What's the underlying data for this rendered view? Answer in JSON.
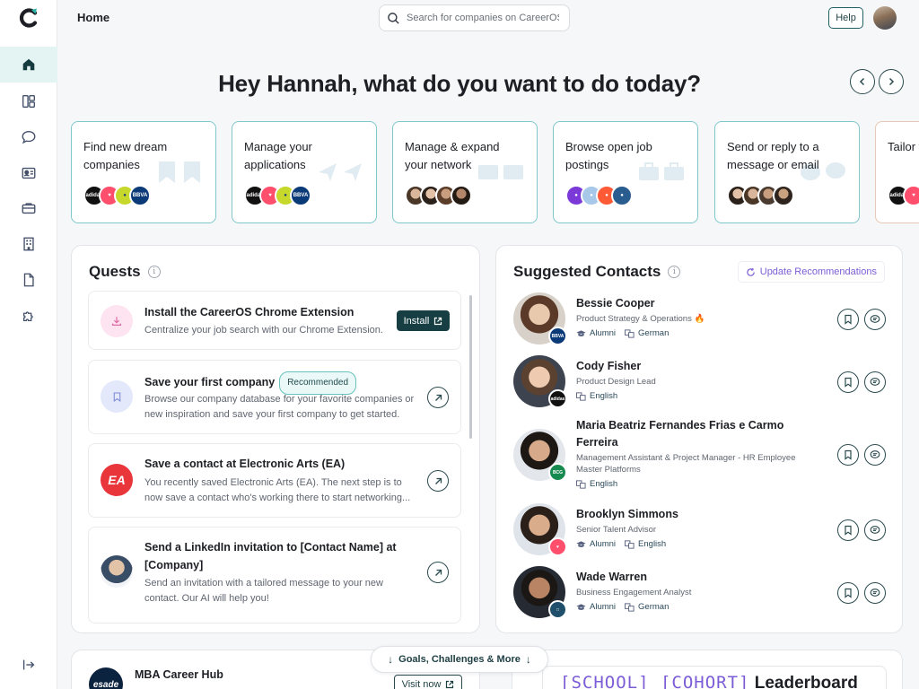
{
  "topbar": {
    "page_title": "Home",
    "search_placeholder": "Search for companies on CareerOS",
    "help_label": "Help"
  },
  "sidebar": {
    "items": [
      {
        "icon": "home-icon",
        "active": true
      },
      {
        "icon": "dashboard-icon",
        "active": false
      },
      {
        "icon": "chat-icon",
        "active": false
      },
      {
        "icon": "contact-card-icon",
        "active": false
      },
      {
        "icon": "briefcase-icon",
        "active": false
      },
      {
        "icon": "building-icon",
        "active": false
      },
      {
        "icon": "document-icon",
        "active": false
      },
      {
        "icon": "puzzle-icon",
        "active": false
      }
    ],
    "collapse_icon": "collapse-sidebar-icon"
  },
  "headline": "Hey Hannah, what do you want to do today?",
  "actions": [
    {
      "label": "Find new dream companies",
      "logos": [
        "adidas",
        "tinder",
        "bbva-yellow",
        "BBVA"
      ]
    },
    {
      "label": "Manage your applications",
      "logos": [
        "adidas",
        "tinder",
        "bbva-yellow",
        "BBVA"
      ]
    },
    {
      "label": "Manage & expand your network"
    },
    {
      "label": "Browse open job postings"
    },
    {
      "label": "Send or reply to a message or email"
    },
    {
      "label": "Tailor your resume"
    }
  ],
  "quests": {
    "title": "Quests",
    "items": [
      {
        "title": "Install the CareerOS Chrome Extension",
        "desc": "Centralize your job search with our Chrome Extension.",
        "button": "Install"
      },
      {
        "title": "Save your first company",
        "badge": "Recommended",
        "desc": "Browse our company database for your favorite companies or new inspiration and save your first company to get started."
      },
      {
        "title": "Save a contact at Electronic Arts (EA)",
        "desc": "You recently saved Electronic Arts (EA). The next step is to now save a contact who's working there to start networking..."
      },
      {
        "title": "Send a LinkedIn invitation to [Contact Name] at [Company]",
        "desc": "Send an invitation with a tailored message to your new contact. Our AI will help you!"
      }
    ]
  },
  "contacts": {
    "title": "Suggested Contacts",
    "update_label": "Update Recommendations",
    "items": [
      {
        "name": "Bessie Cooper",
        "role": "Product Strategy & Operations 🔥",
        "tags": [
          "Alumni",
          "German"
        ],
        "company": "BBVA"
      },
      {
        "name": "Cody Fisher",
        "role": "Product Design Lead",
        "tags": [
          "English"
        ],
        "company": "adidas"
      },
      {
        "name": "Maria Beatriz Fernandes Frias e Carmo Ferreira",
        "role": "Management Assistant & Project Manager - HR Employee Master Platforms",
        "tags": [
          "English"
        ],
        "company": "BCG"
      },
      {
        "name": "Brooklyn Simmons",
        "role": "Senior Talent Advisor",
        "tags": [
          "Alumni",
          "English"
        ],
        "company": "tinder"
      },
      {
        "name": "Wade Warren",
        "role": "Business Engagement Analyst",
        "tags": [
          "Alumni",
          "German"
        ],
        "company": "other"
      }
    ]
  },
  "bottom": {
    "goals_label": "Goals, Challenges & More",
    "hub_logo": "esade",
    "hub_title": "MBA Career Hub",
    "visit_label": "Visit now",
    "leaderboard_placeholder": "[SCHOOL] [COHORT]",
    "leaderboard_label": "Leaderboard"
  },
  "colors": {
    "accent": "#173f43",
    "card_border": "#7fc7c9",
    "purple": "#7b5cd6",
    "active_nav": "#e3f4f2"
  }
}
